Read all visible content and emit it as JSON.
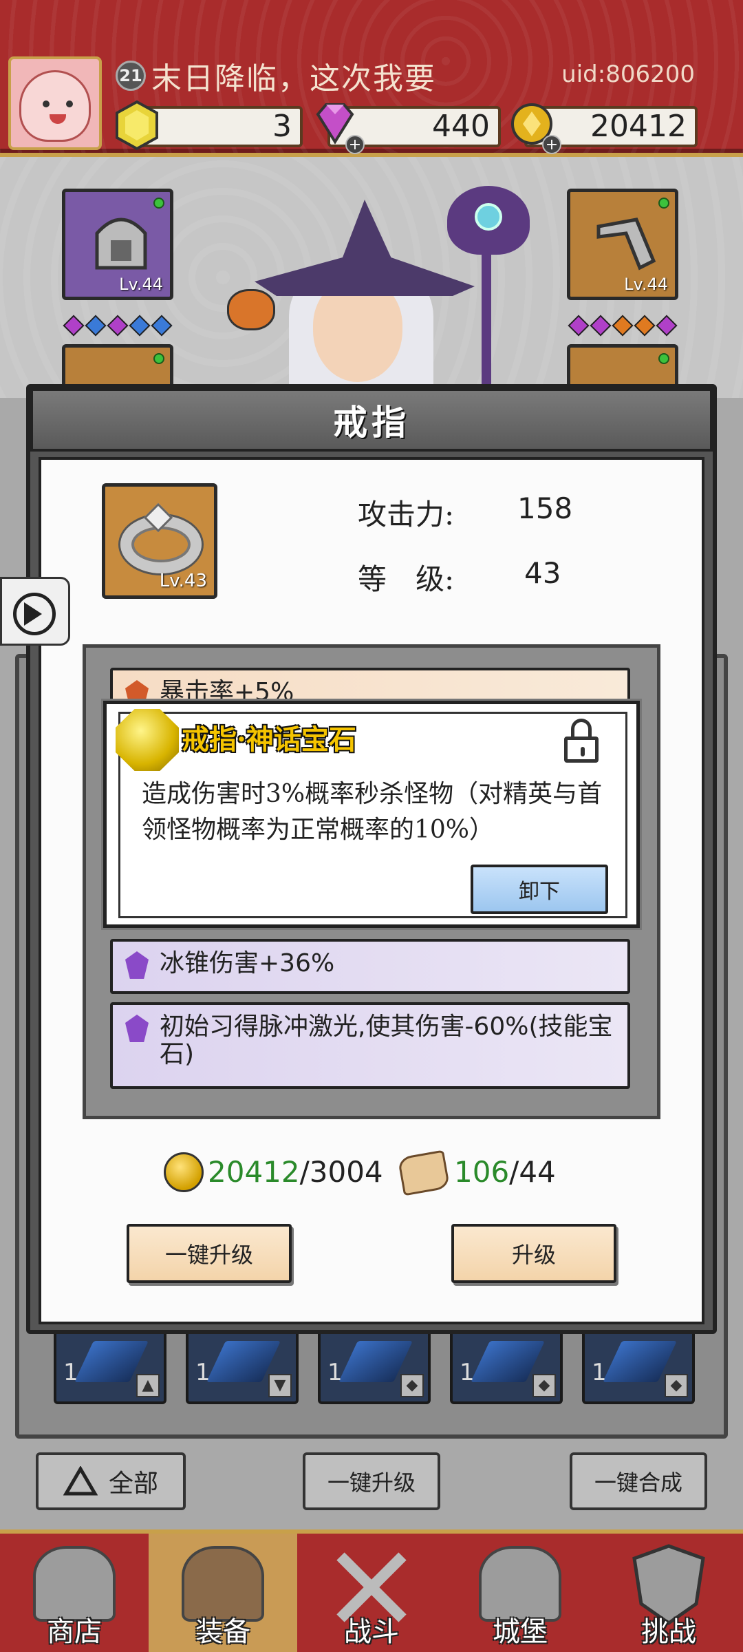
{
  "player": {
    "level": "21",
    "name": "末日降临，这次我要",
    "uid": "uid:806200"
  },
  "resources": {
    "energy": "3",
    "diamonds": "440",
    "gold": "20412"
  },
  "hero": {
    "left_top_slot_level": "Lv.44",
    "right_top_slot_level": "Lv.44"
  },
  "modal": {
    "title": "戒指",
    "item_level": "Lv.43",
    "attack_label": "攻击力:",
    "attack_value": "158",
    "level_label": "等　级:",
    "level_value": "43"
  },
  "gems": [
    {
      "text": "暴击率+5%",
      "color": "orange"
    },
    {
      "text": "冰锥伤害+36%",
      "color": "purple"
    },
    {
      "text": "初始习得脉冲激光,使其伤害-60%(技能宝石)",
      "color": "purple"
    }
  ],
  "popup": {
    "title": "戒指·神话宝石",
    "description": "造成伤害时3%概率秒杀怪物（对精英与首领怪物概率为正常概率的10%）",
    "unequip_label": "卸下"
  },
  "cost": {
    "gold_have": "20412",
    "gold_need": "/3004",
    "scroll_have": "106",
    "scroll_need": "/44"
  },
  "modal_buttons": {
    "quick_upgrade": "一键升级",
    "upgrade": "升级"
  },
  "gem_slots": [
    "1",
    "1",
    "1",
    "1",
    "1"
  ],
  "bottom_buttons": {
    "all": "全部",
    "quick_upgrade": "一键升级",
    "quick_merge": "一键合成"
  },
  "nav": [
    {
      "label": "商店"
    },
    {
      "label": "装备"
    },
    {
      "label": "战斗"
    },
    {
      "label": "城堡"
    },
    {
      "label": "挑战"
    }
  ],
  "colors": {
    "topbar": "#a92c2c",
    "popup_title": "#f5c400",
    "have_amount": "#2a8a2a",
    "gold": "#d3a000"
  }
}
